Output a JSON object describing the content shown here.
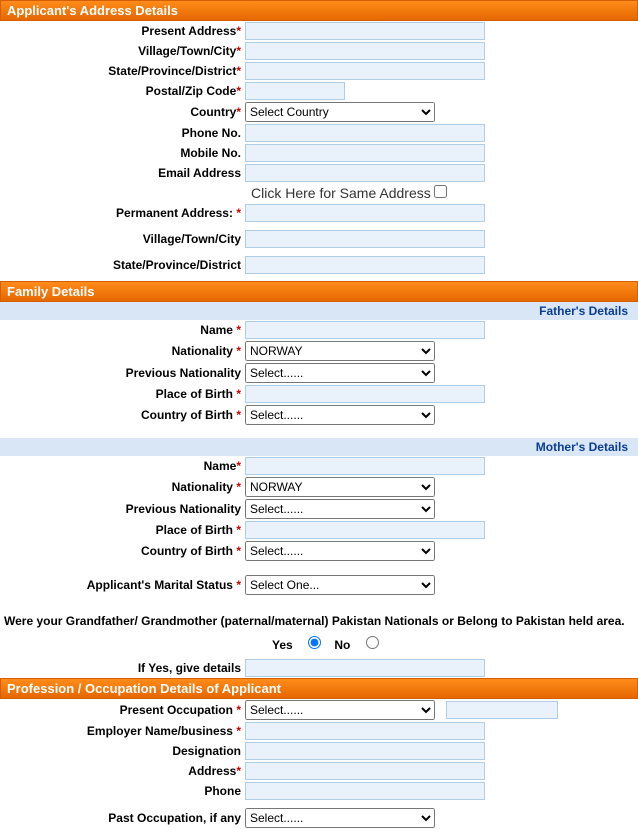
{
  "sections": {
    "address": {
      "title": "Applicant's Address Details",
      "present_address": "Present Address",
      "village": "Village/Town/City",
      "state": "State/Province/District",
      "postal": "Postal/Zip Code",
      "country": "Country",
      "country_selected": "Select Country",
      "phone": "Phone No.",
      "mobile": "Mobile No.",
      "email": "Email Address",
      "same_address": "Click Here for Same Address",
      "permanent_address": "Permanent Address:",
      "perm_village": "Village/Town/City",
      "perm_state": "State/Province/District"
    },
    "family": {
      "title": "Family Details",
      "father": "Father's Details",
      "mother": "Mother's Details",
      "name": "Name",
      "nationality": "Nationality",
      "nationality_selected": "NORWAY",
      "prev_nationality": "Previous Nationality",
      "prev_nationality_selected": "Select......",
      "place_of_birth": "Place of Birth",
      "country_of_birth": "Country of Birth",
      "country_of_birth_selected": "Select......"
    },
    "marital": {
      "label": "Applicant's Marital Status",
      "selected": "Select One..."
    },
    "grandparent": {
      "question": "Were your Grandfather/ Grandmother (paternal/maternal) Pakistan Nationals or Belong to Pakistan held area.",
      "yes": "Yes",
      "no": "No",
      "if_yes": "If Yes, give details"
    },
    "profession": {
      "title": "Profession / Occupation Details of Applicant",
      "present_occ": "Present Occupation",
      "present_occ_selected": "Select......",
      "employer": "Employer Name/business",
      "designation": "Designation",
      "address": "Address",
      "phone": "Phone",
      "past_occ": "Past Occupation, if any",
      "past_occ_selected": "Select......"
    }
  }
}
